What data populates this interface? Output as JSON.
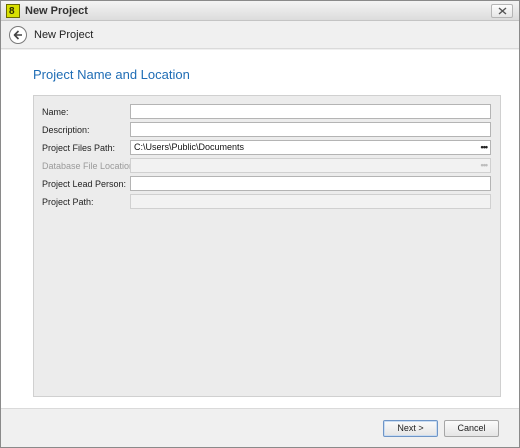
{
  "window": {
    "title": "New Project",
    "app_icon_text": "8"
  },
  "nav": {
    "title": "New Project"
  },
  "page": {
    "heading": "Project Name and Location"
  },
  "form": {
    "fields": [
      {
        "label": "Name:",
        "value": "",
        "disabled": false,
        "browse": false
      },
      {
        "label": "Description:",
        "value": "",
        "disabled": false,
        "browse": false
      },
      {
        "label": "Project Files Path:",
        "value": "C:\\Users\\Public\\Documents",
        "disabled": false,
        "browse": true
      },
      {
        "label": "Database File Location:",
        "value": "",
        "disabled": true,
        "browse": true
      },
      {
        "label": "Project Lead Person:",
        "value": "",
        "disabled": false,
        "browse": false
      },
      {
        "label": "Project Path:",
        "value": "",
        "disabled": true,
        "browse": false
      }
    ],
    "browse_glyph": "•••"
  },
  "footer": {
    "next_label": "Next >",
    "cancel_label": "Cancel"
  },
  "colors": {
    "heading": "#1f6db5",
    "app_icon": "#d8e000"
  },
  "icons": {
    "back": "arrow-left-icon",
    "close": "close-icon"
  }
}
